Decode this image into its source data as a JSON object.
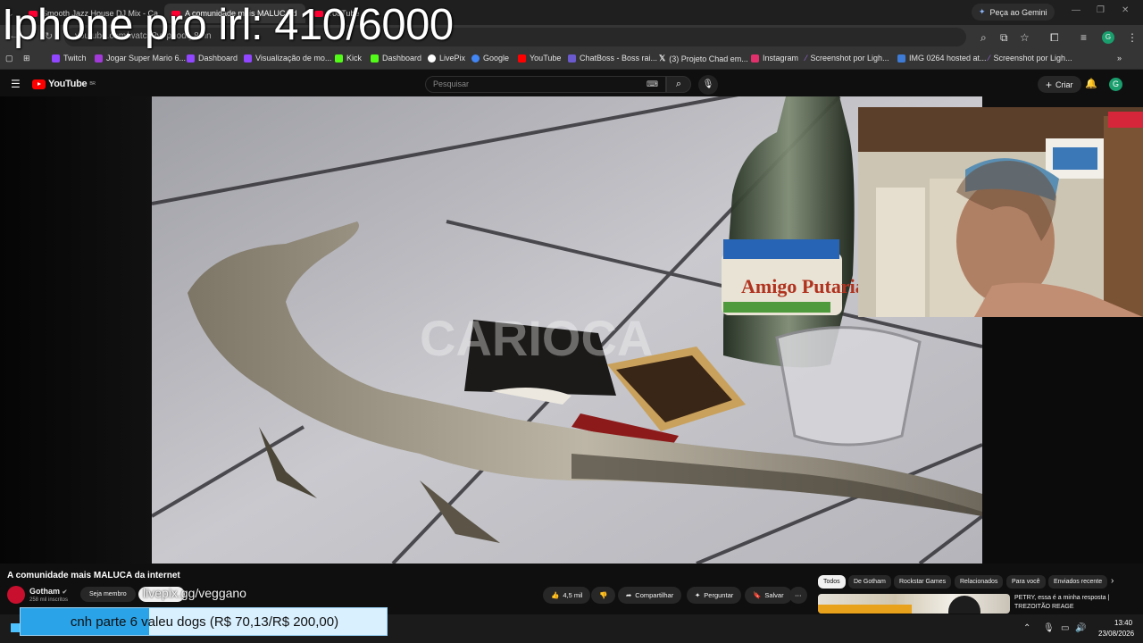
{
  "overlay": {
    "counter_text": "Iphone pro irl: 410/6000"
  },
  "browser": {
    "tabs": [
      {
        "label": "Smooth Jazz House DJ Mix - Ca",
        "active": false
      },
      {
        "label": "A comunidade mais MALUCA d",
        "active": true
      },
      {
        "label": "YouTube",
        "active": false
      }
    ],
    "gemini_label": "Peça ao Gemini",
    "url": "youtube.com/watch?v=pnodI_8mn",
    "profile_initial": "G",
    "bookmarks": [
      {
        "label": "Twitch",
        "color": "#9146ff"
      },
      {
        "label": "Jogar Super Mario 6...",
        "color": "#a13ad8"
      },
      {
        "label": "Dashboard",
        "color": "#9146ff"
      },
      {
        "label": "Visualização de mo...",
        "color": "#9146ff"
      },
      {
        "label": "Kick",
        "color": "#53fc18"
      },
      {
        "label": "Dashboard",
        "color": "#53fc18"
      },
      {
        "label": "LivePix",
        "color": "#ffffff"
      },
      {
        "label": "Google",
        "color": "#4285f4"
      },
      {
        "label": "YouTube",
        "color": "#ff0000"
      },
      {
        "label": "ChatBoss - Boss rai...",
        "color": "#6a5acd"
      },
      {
        "label": "(3) Projeto Chad em...",
        "color": "#000000"
      },
      {
        "label": "Instagram",
        "color": "#e1306c"
      },
      {
        "label": "Screenshot por Ligh...",
        "color": "#9c6ade"
      },
      {
        "label": "IMG 0264 hosted at...",
        "color": "#3d7bd6"
      },
      {
        "label": "Screenshot por Ligh...",
        "color": "#9c6ade"
      }
    ]
  },
  "youtube": {
    "logo_text": "YouTube",
    "country_code": "BR",
    "search_placeholder": "Pesquisar",
    "create_label": "Criar",
    "avatar_initial": "G",
    "video_title": "A comunidade mais MALUCA da internet",
    "watermark": "CARIOCA",
    "bottle_label": "Amigo Putaria",
    "channel": {
      "name": "Gotham",
      "subs": "258 mil inscritos"
    },
    "member_label": "Seja membro",
    "promo_text": "livepix.gg/veggano",
    "actions": {
      "likes": "4,5 mil",
      "share": "Compartilhar",
      "ask": "Perguntar",
      "save": "Salvar",
      "more": "⋯"
    },
    "chips": [
      "Todos",
      "De Gotham",
      "Rockstar Games",
      "Relacionados",
      "Para você",
      "Enviados recente"
    ],
    "recommendation_title": "PETRY, essa é a minha resposta | TREZOITÃO REAGE"
  },
  "donation": {
    "text": "cnh parte 6 valeu dogs (R$ 70,13/R$ 200,00)",
    "progress": 0.35
  },
  "taskbar": {
    "time": "13:40",
    "date": "23/08/2026"
  },
  "colors": {
    "youtube_red": "#ff0000",
    "donation_fill": "#2aa3e8",
    "donation_bg": "#d9f0ff"
  }
}
